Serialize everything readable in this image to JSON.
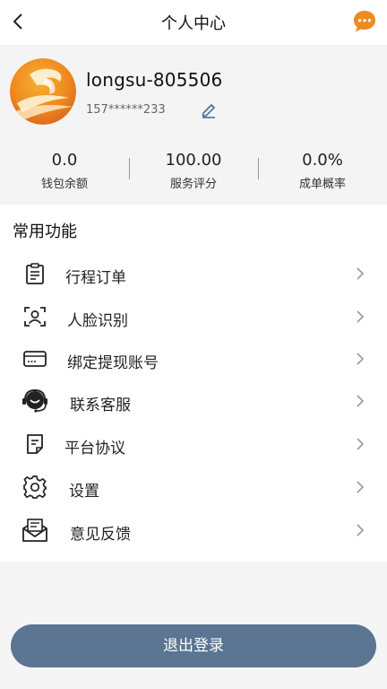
{
  "header": {
    "title": "个人中心",
    "back_icon": "chevron-left-icon",
    "chat_icon": "chat-bubble-icon",
    "chat_color": "#ef8a1f"
  },
  "profile": {
    "username": "longsu-805506",
    "phone": "157******233",
    "edit_icon": "pencil-icon"
  },
  "stats": [
    {
      "value": "0.0",
      "label": "钱包余额"
    },
    {
      "value": "100.00",
      "label": "服务评分"
    },
    {
      "value": "0.0%",
      "label": "成单概率"
    }
  ],
  "functions": {
    "title": "常用功能",
    "items": [
      {
        "label": "行程订单",
        "icon": "clipboard-icon"
      },
      {
        "label": "人脸识别",
        "icon": "face-scan-icon"
      },
      {
        "label": "绑定提现账号",
        "icon": "card-icon"
      },
      {
        "label": "联系客服",
        "icon": "headset-icon"
      },
      {
        "label": "平台协议",
        "icon": "document-icon"
      },
      {
        "label": "设置",
        "icon": "gear-icon"
      },
      {
        "label": "意见反馈",
        "icon": "mail-icon"
      }
    ]
  },
  "logout": {
    "label": "退出登录",
    "color": "#5b7592"
  }
}
